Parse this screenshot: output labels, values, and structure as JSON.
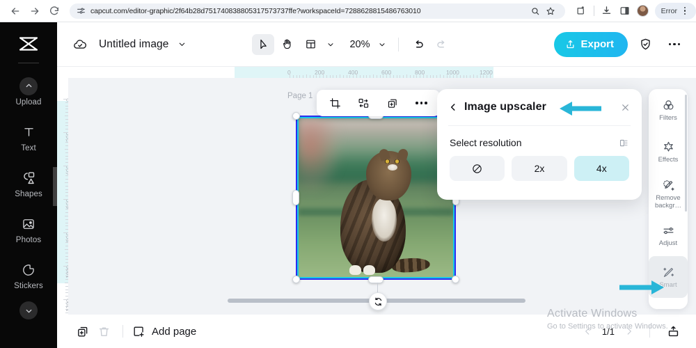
{
  "browser": {
    "url": "capcut.com/editor-graphic/2f64b28d751740838805317573737ffe?workspaceId=7288628815486763010",
    "back_icon": "back-arrow-icon",
    "forward_icon": "forward-arrow-icon",
    "reload_icon": "reload-icon",
    "site_info_icon": "site-settings-icon",
    "zoom_icon": "page-zoom-icon",
    "bookmark_icon": "star-icon",
    "extensions_icon": "extensions-icon",
    "downloads_icon": "downloads-icon",
    "sidepanel_icon": "side-panel-icon",
    "profile_icon": "avatar",
    "error_label": "Error",
    "menu_icon": "chrome-menu-icon"
  },
  "left_rail": {
    "logo": "capcut-logo",
    "items": [
      {
        "label": "Upload",
        "icon": "upload-icon"
      },
      {
        "label": "Text",
        "icon": "text-icon"
      },
      {
        "label": "Shapes",
        "icon": "shapes-icon"
      },
      {
        "label": "Photos",
        "icon": "photos-icon"
      },
      {
        "label": "Stickers",
        "icon": "stickers-icon"
      }
    ],
    "collapse_icon": "chevron-down-icon"
  },
  "toolbar": {
    "cloud_icon": "cloud-saved-icon",
    "doc_title": "Untitled image",
    "title_caret_icon": "chevron-down-icon",
    "select_tool_icon": "cursor-select-icon",
    "hand_tool_icon": "hand-pan-icon",
    "layout_tool_icon": "layout-icon",
    "layout_caret_icon": "chevron-down-icon",
    "zoom_value": "20%",
    "zoom_caret_icon": "chevron-down-icon",
    "undo_icon": "undo-icon",
    "redo_icon": "redo-icon",
    "export_label": "Export",
    "export_icon": "export-upload-icon",
    "shield_icon": "shield-check-icon",
    "more_icon": "more-horizontal-icon",
    "export_color": "#18c8e6"
  },
  "canvas": {
    "page_label": "Page 1",
    "ruler_h_ticks": [
      "0",
      "200",
      "400",
      "600",
      "800",
      "1000",
      "1200"
    ],
    "ruler_v_ticks": [
      "0",
      "200",
      "400",
      "600",
      "800",
      "1000",
      "1200"
    ],
    "ruler_highlight_color": "#dff5f7",
    "selection_color": "#2d2ef0",
    "selection_inner_color": "#18c8e6",
    "element_toolbar": [
      {
        "icon": "crop-icon"
      },
      {
        "icon": "replace-media-icon"
      },
      {
        "icon": "duplicate-icon"
      },
      {
        "icon": "more-horizontal-icon"
      }
    ],
    "rotate_icon": "rotate-icon",
    "scrollbar": "horizontal-scrollbar",
    "image_alt": "cat-photo"
  },
  "panel": {
    "back_icon": "chevron-left-icon",
    "title": "Image upscaler",
    "close_icon": "close-icon",
    "section_label": "Select resolution",
    "compare_icon": "compare-split-icon",
    "options": [
      {
        "label": "",
        "icon": "no-upscale-icon",
        "selected": false
      },
      {
        "label": "2x",
        "icon": "",
        "selected": false
      },
      {
        "label": "4x",
        "icon": "",
        "selected": true
      }
    ],
    "selected_color": "#cdf0f5"
  },
  "right_rail": {
    "items": [
      {
        "label": "Filters",
        "icon": "filters-icon",
        "selected": false
      },
      {
        "label": "Effects",
        "icon": "effects-icon",
        "selected": false
      },
      {
        "label": "Remove backgr…",
        "icon": "remove-background-icon",
        "selected": false
      },
      {
        "label": "Adjust",
        "icon": "adjust-sliders-icon",
        "selected": false
      },
      {
        "label": "Smart",
        "icon": "smart-magic-wand-icon",
        "selected": true
      }
    ]
  },
  "bottom_bar": {
    "duplicate_page_icon": "duplicate-page-icon",
    "delete_page_icon": "trash-icon",
    "add_page_label": "Add page",
    "add_page_icon": "add-page-icon",
    "prev_page_icon": "chevron-left-icon",
    "page_count": "1/1",
    "next_page_icon": "chevron-right-icon",
    "present_icon": "present-icon"
  },
  "watermark": {
    "line1": "Activate Windows",
    "line2": "Go to Settings to activate Windows."
  },
  "annotations": {
    "arrow_color": "#29b6d8",
    "arrow_1_target": "image-upscaler-title",
    "arrow_2_target": "right-rail-smart"
  }
}
